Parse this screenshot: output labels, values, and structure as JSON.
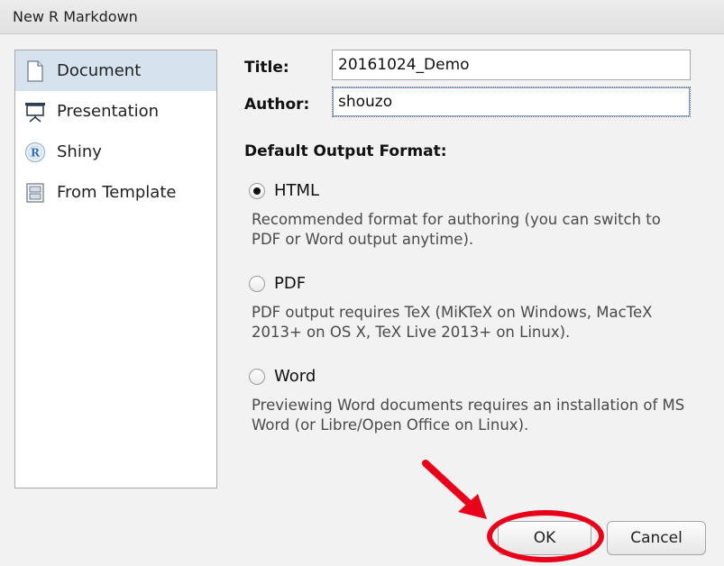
{
  "window": {
    "title": "New R Markdown"
  },
  "sidebar": {
    "items": [
      {
        "label": "Document",
        "icon": "document-icon",
        "selected": true
      },
      {
        "label": "Presentation",
        "icon": "presentation-icon",
        "selected": false
      },
      {
        "label": "Shiny",
        "icon": "shiny-icon",
        "selected": false
      },
      {
        "label": "From Template",
        "icon": "template-icon",
        "selected": false
      }
    ]
  },
  "form": {
    "title_label": "Title:",
    "title_value": "20161024_Demo",
    "author_label": "Author:",
    "author_value": "shouzo"
  },
  "output": {
    "heading": "Default Output Format:",
    "options": [
      {
        "label": "HTML",
        "checked": true,
        "description": "Recommended format for authoring (you can switch to PDF or Word output anytime)."
      },
      {
        "label": "PDF",
        "checked": false,
        "description": "PDF output requires TeX (MiKTeX on Windows, MacTeX 2013+ on OS X, TeX Live 2013+ on Linux)."
      },
      {
        "label": "Word",
        "checked": false,
        "description": "Previewing Word documents requires an installation of MS Word (or Libre/Open Office on Linux)."
      }
    ]
  },
  "buttons": {
    "ok": "OK",
    "cancel": "Cancel"
  },
  "annotation": {
    "color": "#e8001a"
  }
}
